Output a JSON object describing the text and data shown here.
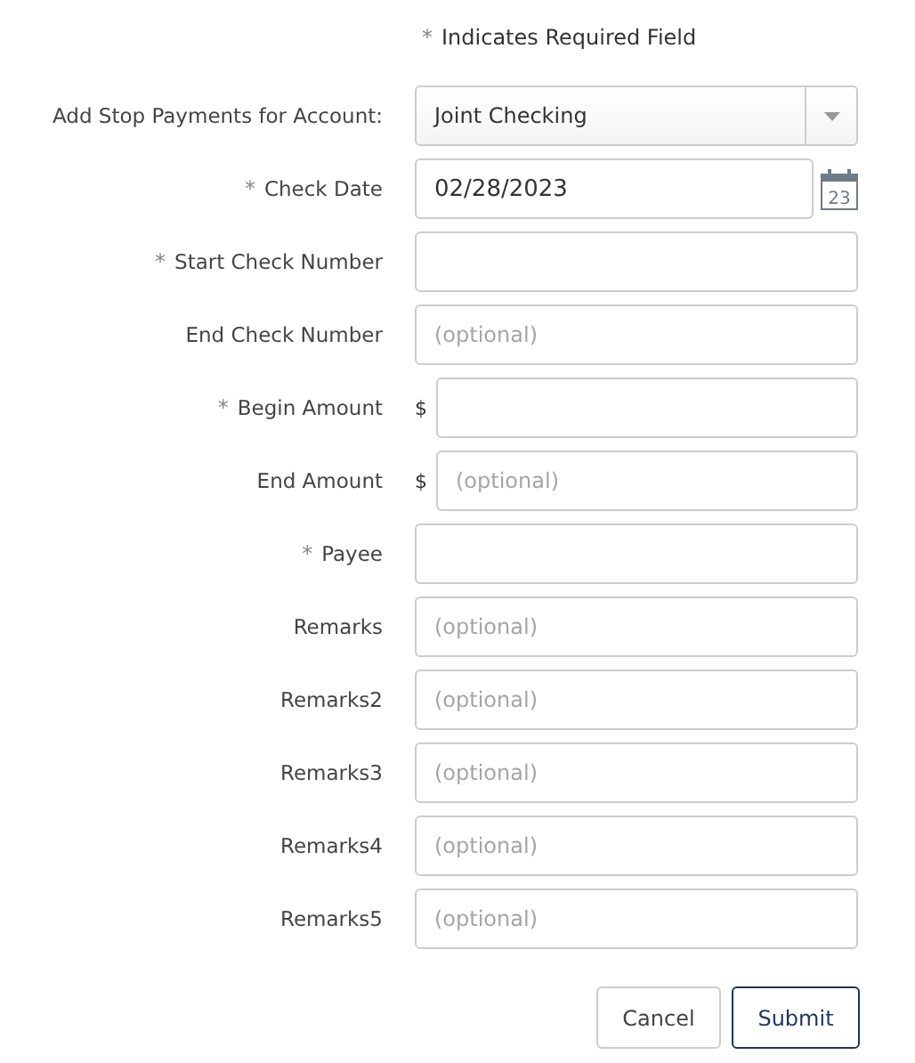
{
  "required_note": {
    "mark": "*",
    "text": "Indicates Required Field"
  },
  "fields": [
    {
      "kind": "select",
      "label": "Add Stop Payments for Account:",
      "required": false,
      "value": "Joint Checking"
    },
    {
      "kind": "date",
      "label": "Check Date",
      "required": true,
      "value": "02/28/2023",
      "calendar_day": "23"
    },
    {
      "kind": "text",
      "label": "Start Check Number",
      "required": true
    },
    {
      "kind": "text",
      "label": "End Check Number",
      "required": false,
      "placeholder": "(optional)"
    },
    {
      "kind": "currency",
      "label": "Begin Amount",
      "required": true,
      "prefix": "$"
    },
    {
      "kind": "currency",
      "label": "End Amount",
      "required": false,
      "prefix": "$",
      "placeholder": "(optional)"
    },
    {
      "kind": "text",
      "label": "Payee",
      "required": true
    },
    {
      "kind": "text",
      "label": "Remarks",
      "required": false,
      "placeholder": "(optional)"
    },
    {
      "kind": "text",
      "label": "Remarks2",
      "required": false,
      "placeholder": "(optional)"
    },
    {
      "kind": "text",
      "label": "Remarks3",
      "required": false,
      "placeholder": "(optional)"
    },
    {
      "kind": "text",
      "label": "Remarks4",
      "required": false,
      "placeholder": "(optional)"
    },
    {
      "kind": "text",
      "label": "Remarks5",
      "required": false,
      "placeholder": "(optional)"
    }
  ],
  "buttons": [
    {
      "label": "Cancel",
      "kind": "secondary"
    },
    {
      "label": "Submit",
      "kind": "primary"
    }
  ]
}
